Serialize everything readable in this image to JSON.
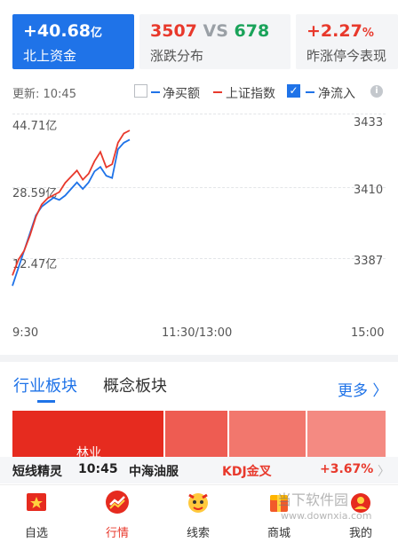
{
  "cards": [
    {
      "value": "+40.68",
      "unit": "亿",
      "label": "北上资金",
      "active": true
    },
    {
      "up": "3507",
      "vs": "VS",
      "down": "678",
      "label": "涨跌分布"
    },
    {
      "value": "+2.27",
      "unit": "%",
      "label": "昨涨停今表现"
    }
  ],
  "legend": {
    "update": "更新: 10:45",
    "items": [
      {
        "label": "净买额",
        "checked": false,
        "color": "#1f73e8"
      },
      {
        "label": "上证指数",
        "checked": false,
        "color": "#e8392c"
      },
      {
        "label": "净流入",
        "checked": true,
        "color": "#1f73e8"
      }
    ],
    "info_icon": "info-icon"
  },
  "chart_data": {
    "type": "line",
    "x_ticks": [
      "9:30",
      "11:30/13:00",
      "15:00"
    ],
    "y_left_ticks": [
      "44.71亿",
      "28.59亿",
      "12.47亿"
    ],
    "y_right_ticks": [
      "3433",
      "3410",
      "3387"
    ],
    "series": [
      {
        "color": "#1f73e8",
        "axis": "left",
        "y": [
          8,
          12,
          16,
          20,
          24,
          26,
          27,
          28,
          27.5,
          28.5,
          30,
          31.5,
          30,
          31.5,
          34,
          35,
          33,
          32.5,
          39,
          40.5,
          41.2
        ]
      },
      {
        "color": "#e8392c",
        "axis": "right",
        "y": [
          3384,
          3389,
          3392,
          3397,
          3403,
          3407,
          3409,
          3410,
          3411,
          3414,
          3416,
          3418,
          3415,
          3417,
          3421,
          3424,
          3419,
          3420,
          3427,
          3430,
          3431
        ]
      }
    ]
  },
  "sectors": {
    "tabs": [
      "行业板块",
      "概念板块"
    ],
    "more": "更多",
    "blocks": [
      {
        "color": "#e62b1f"
      },
      {
        "color": "#ee5c52"
      },
      {
        "color": "#f2776d"
      },
      {
        "color": "#f48a82"
      }
    ],
    "first_label": "林业"
  },
  "ticker": {
    "name": "短线精灵",
    "time": "10:45",
    "stock": "中海油服",
    "signal": "KDJ金叉",
    "change": "+3.67%"
  },
  "nav": [
    {
      "label": "自选",
      "icon": "watchlist-icon"
    },
    {
      "label": "行情",
      "icon": "market-icon",
      "active": true
    },
    {
      "label": "线索",
      "icon": "clue-icon"
    },
    {
      "label": "商城",
      "icon": "mall-icon"
    },
    {
      "label": "我的",
      "icon": "profile-icon"
    }
  ],
  "watermark": {
    "text": "当下软件园",
    "url": "www.downxia.com"
  }
}
